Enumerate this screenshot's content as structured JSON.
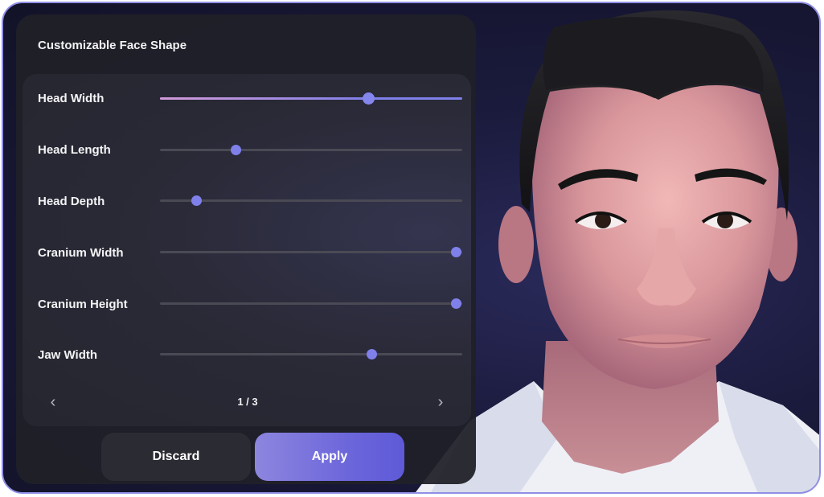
{
  "panel": {
    "title": "Customizable Face Shape",
    "sliders": [
      {
        "label": "Head Width",
        "value": 0.69,
        "active": true
      },
      {
        "label": "Head Length",
        "value": 0.25,
        "active": false
      },
      {
        "label": "Head Depth",
        "value": 0.12,
        "active": false
      },
      {
        "label": "Cranium Width",
        "value": 0.98,
        "active": false
      },
      {
        "label": "Cranium Height",
        "value": 0.98,
        "active": false
      },
      {
        "label": "Jaw Width",
        "value": 0.7,
        "active": false
      }
    ],
    "pager": {
      "text": "1 / 3",
      "prev_icon": "chevron-left-icon",
      "next_icon": "chevron-right-icon"
    }
  },
  "buttons": {
    "discard": "Discard",
    "apply": "Apply"
  },
  "colors": {
    "accent": "#7f80ea",
    "gradient_start": "#d39ad8",
    "panel_bg": "#202028",
    "apply_bg": "#6d67db"
  }
}
